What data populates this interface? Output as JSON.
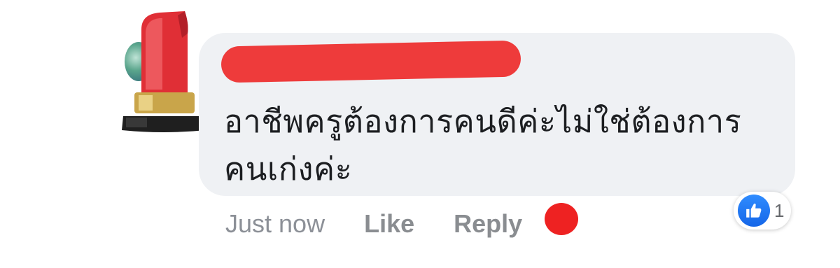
{
  "comment": {
    "author_redacted": true,
    "text": "อาชีพครูต้องการคนดีค่ะไม่ใช่ต้องการ\nคนเก่งค่ะ"
  },
  "actions": {
    "time": "Just now",
    "like_label": "Like",
    "reply_label": "Reply"
  },
  "reactions": {
    "icon": "thumbs-up-icon",
    "count": "1"
  },
  "colors": {
    "bubble": "#eff1f4",
    "redaction": "#ee3b3b",
    "like_blue": "#1877f2",
    "text": "#1c1e21",
    "meta": "#8a8d91"
  },
  "avatar": {
    "icon": "lipstick-icon"
  }
}
